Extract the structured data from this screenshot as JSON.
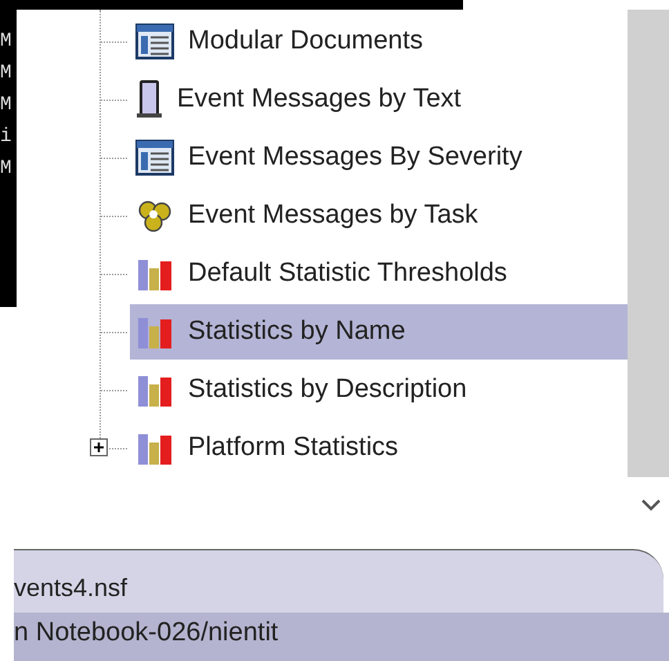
{
  "console": {
    "lines": [
      "M",
      "M",
      "M",
      "i",
      "M"
    ]
  },
  "tree": {
    "items": [
      {
        "label": "Modular Documents",
        "kind": "view",
        "selected": false
      },
      {
        "label": "Event Messages by Text",
        "kind": "device",
        "selected": false
      },
      {
        "label": "Event Messages By Severity",
        "kind": "view",
        "selected": false
      },
      {
        "label": "Event Messages by Task",
        "kind": "gear",
        "selected": false
      },
      {
        "label": "Default Statistic Thresholds",
        "kind": "chart",
        "selected": false
      },
      {
        "label": "Statistics by Name",
        "kind": "chart",
        "selected": true
      },
      {
        "label": "Statistics by Description",
        "kind": "chart",
        "selected": false
      },
      {
        "label": "Platform Statistics",
        "kind": "chart",
        "selected": false,
        "expandable": true,
        "expanded": false
      }
    ]
  },
  "tab": {
    "label": "vents4.nsf"
  },
  "status_bar": {
    "text": "n Notebook-026/nientit"
  }
}
